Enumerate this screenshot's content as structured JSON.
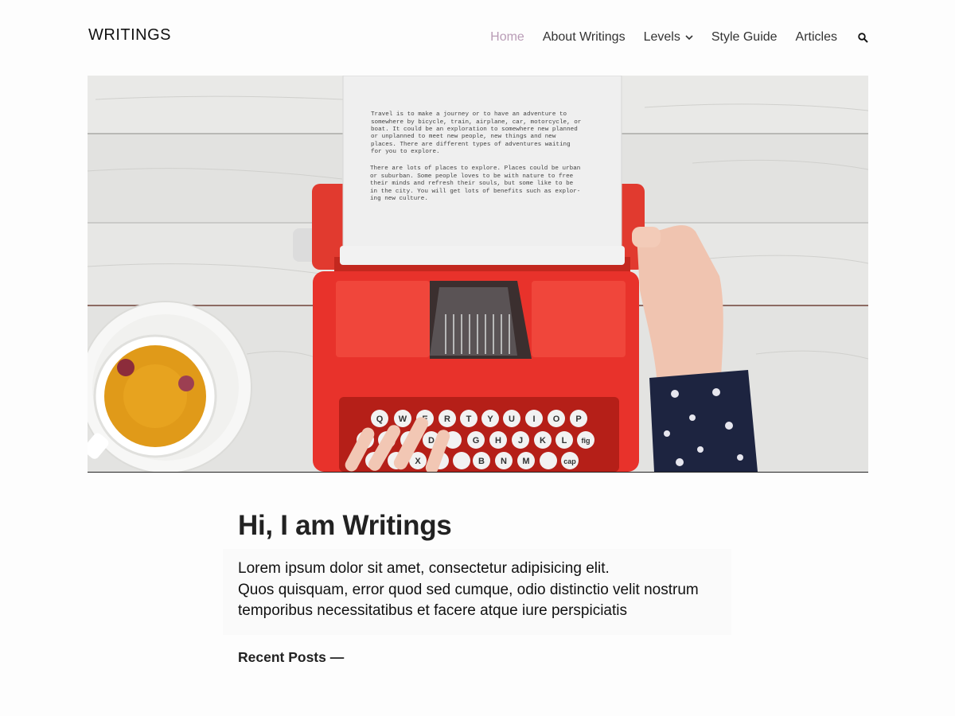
{
  "site": {
    "title": "WRITINGS"
  },
  "nav": {
    "items": [
      {
        "label": "Home",
        "active": true
      },
      {
        "label": "About Writings"
      },
      {
        "label": "Levels",
        "has_dropdown": true
      },
      {
        "label": "Style Guide"
      },
      {
        "label": "Articles"
      }
    ],
    "search_icon": "search-icon"
  },
  "hero": {
    "paper_text": [
      "Travel is to make a journey or to have an adventure to",
      "somewhere by bicycle, train, airplane, car, motorcycle, or",
      "boat. It could be an exploration to somewhere new planned",
      "or unplanned to meet new people, new things and new",
      "places. There are different types of adventures waiting",
      "for you to explore.",
      "",
      "There are lots of places to explore. Places could be urban",
      "or suburban. Some people loves to be with nature to free",
      "their minds and refresh their souls, but some like to be",
      "in the city. You will get lots of benefits such as explor-",
      "ing new culture."
    ],
    "keys_row1": [
      "Q",
      "W",
      "E",
      "R",
      "T",
      "Y",
      "U",
      "I",
      "O",
      "P"
    ],
    "keys_row2": [
      "",
      "&",
      "",
      "D",
      "",
      "G",
      "H",
      "J",
      "K",
      "L",
      "fig"
    ],
    "keys_row3": [
      "",
      "",
      "X",
      "",
      "",
      "B",
      "N",
      "M",
      "",
      "cap"
    ]
  },
  "main": {
    "heading": "Hi, I am Writings",
    "intro_lines": [
      "Lorem ipsum dolor sit amet, consectetur adipisicing elit.",
      "Quos quisquam, error quod sed cumque, odio distinctio velit nostrum",
      "temporibus necessitatibus et facere atque iure perspiciatis"
    ],
    "recent_posts": "Recent Posts —"
  },
  "colors": {
    "accent_active_nav": "#b99cb6",
    "typewriter_red": "#e8322b",
    "text": "#222222"
  }
}
